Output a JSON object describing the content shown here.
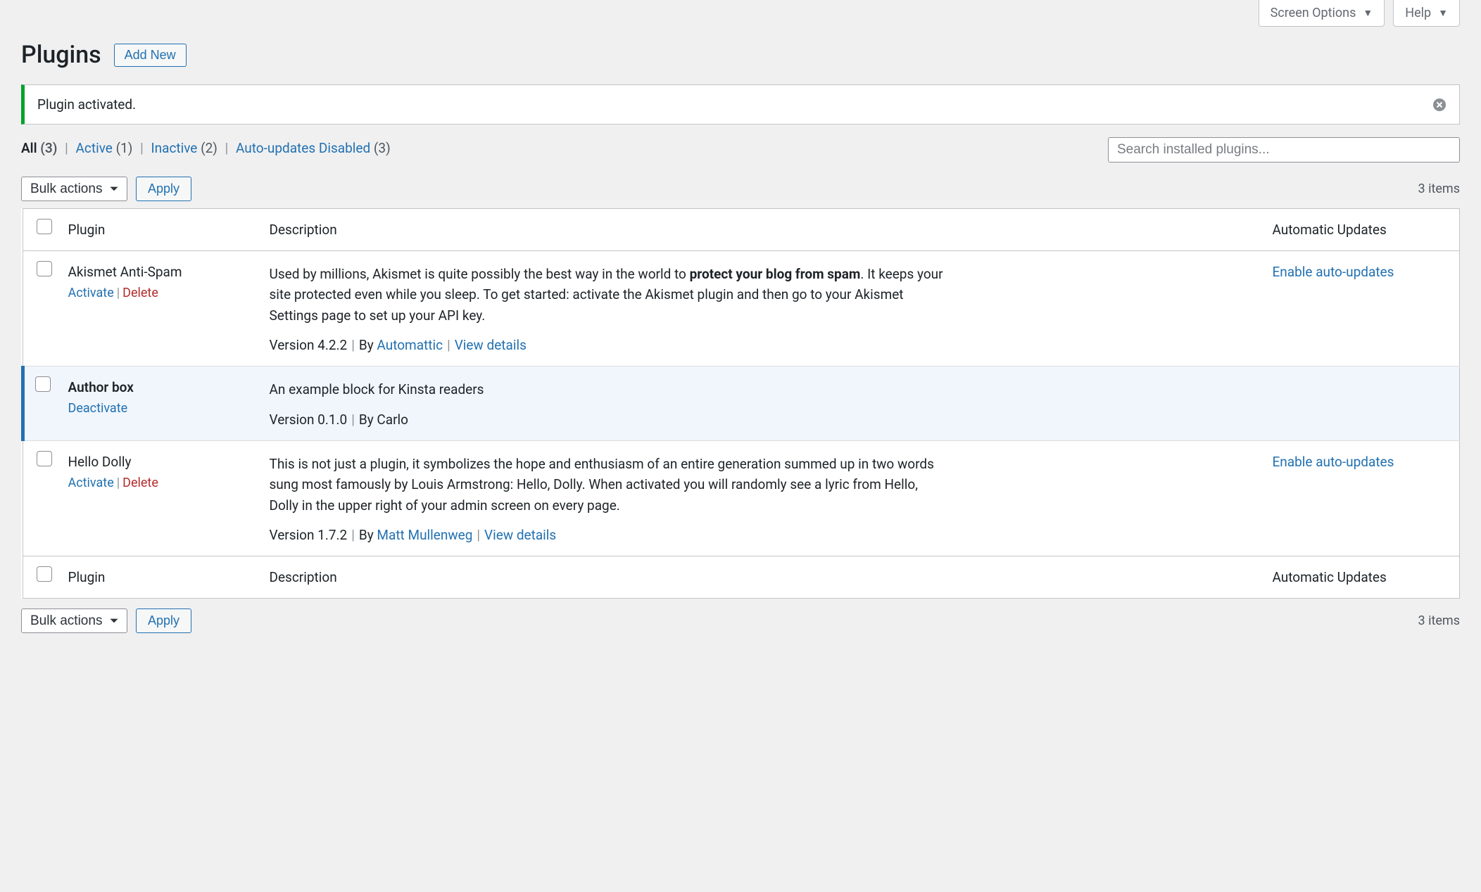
{
  "topTabs": {
    "screenOptions": "Screen Options",
    "help": "Help"
  },
  "header": {
    "title": "Plugins",
    "addNew": "Add New"
  },
  "notice": {
    "message": "Plugin activated."
  },
  "filters": {
    "all": {
      "label": "All",
      "count": "(3)"
    },
    "active": {
      "label": "Active",
      "count": "(1)"
    },
    "inactive": {
      "label": "Inactive",
      "count": "(2)"
    },
    "autoDisabled": {
      "label": "Auto-updates Disabled",
      "count": "(3)"
    }
  },
  "search": {
    "placeholder": "Search installed plugins..."
  },
  "bulk": {
    "label": "Bulk actions",
    "apply": "Apply"
  },
  "pagination": {
    "items": "3 items"
  },
  "columns": {
    "plugin": "Plugin",
    "description": "Description",
    "auto": "Automatic Updates"
  },
  "actions": {
    "activate": "Activate",
    "deactivate": "Deactivate",
    "delete": "Delete",
    "viewDetails": "View details",
    "enableAuto": "Enable auto-updates",
    "by": "By"
  },
  "plugins": [
    {
      "name": "Akismet Anti-Spam",
      "active": false,
      "desc_pre": "Used by millions, Akismet is quite possibly the best way in the world to ",
      "desc_strong": "protect your blog from spam",
      "desc_post": ". It keeps your site protected even while you sleep. To get started: activate the Akismet plugin and then go to your Akismet Settings page to set up your API key.",
      "version": "Version 4.2.2",
      "author": "Automattic",
      "authorLink": true,
      "hasDetails": true,
      "autoUpdate": true
    },
    {
      "name": "Author box",
      "active": true,
      "desc_pre": "An example block for Kinsta readers",
      "desc_strong": "",
      "desc_post": "",
      "version": "Version 0.1.0",
      "author": "Carlo",
      "authorLink": false,
      "hasDetails": false,
      "autoUpdate": false
    },
    {
      "name": "Hello Dolly",
      "active": false,
      "desc_pre": "This is not just a plugin, it symbolizes the hope and enthusiasm of an entire generation summed up in two words sung most famously by Louis Armstrong: Hello, Dolly. When activated you will randomly see a lyric from Hello, Dolly in the upper right of your admin screen on every page.",
      "desc_strong": "",
      "desc_post": "",
      "version": "Version 1.7.2",
      "author": "Matt Mullenweg",
      "authorLink": true,
      "hasDetails": true,
      "autoUpdate": true
    }
  ]
}
